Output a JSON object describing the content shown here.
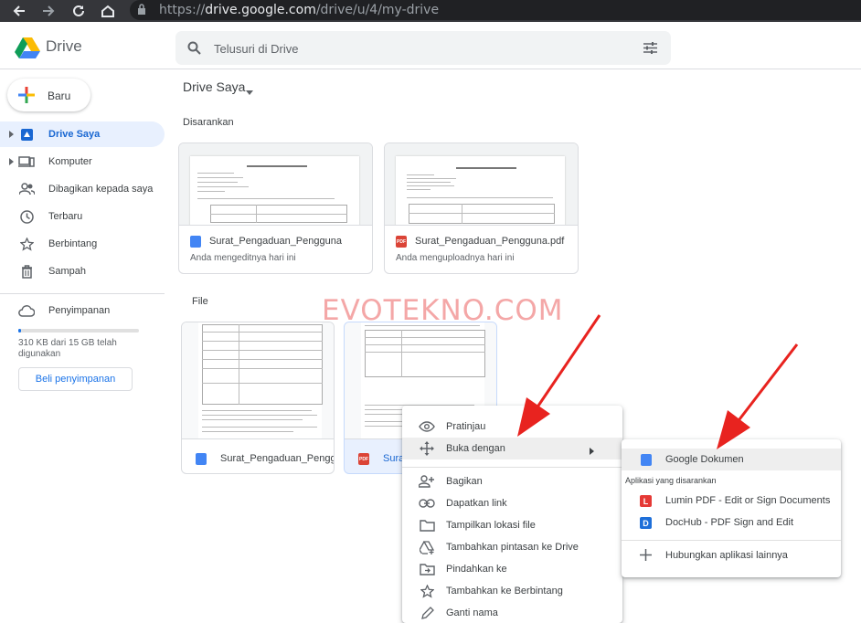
{
  "browser": {
    "url_prefix": "https://",
    "url_host": "drive.google.com",
    "url_path": "/drive/u/4/my-drive"
  },
  "header": {
    "app_name": "Drive",
    "search_placeholder": "Telusuri di Drive"
  },
  "sidebar": {
    "new_label": "Baru",
    "items": [
      {
        "label": "Drive Saya",
        "icon": "my-drive-icon",
        "active": true
      },
      {
        "label": "Komputer",
        "icon": "computer-icon"
      },
      {
        "label": "Dibagikan kepada saya",
        "icon": "shared-icon"
      },
      {
        "label": "Terbaru",
        "icon": "clock-icon"
      },
      {
        "label": "Berbintang",
        "icon": "star-icon"
      },
      {
        "label": "Sampah",
        "icon": "trash-icon"
      }
    ],
    "storage_label": "Penyimpanan",
    "storage_text": "310 KB dari 15 GB telah digunakan",
    "storage_fraction": 2e-05,
    "buy_label": "Beli penyimpanan"
  },
  "main": {
    "breadcrumb": "Drive Saya",
    "suggested_heading": "Disarankan",
    "file_heading": "File",
    "suggested": [
      {
        "name": "Surat_Pengaduan_Pengguna",
        "type": "doc",
        "activity": "Anda mengeditnya hari ini"
      },
      {
        "name": "Surat_Pengaduan_Pengguna.pdf",
        "type": "pdf",
        "activity": "Anda menguploadnya hari ini"
      }
    ],
    "files": [
      {
        "name": "Surat_Pengaduan_Pengg",
        "type": "doc"
      },
      {
        "name": "Surat",
        "type": "pdf"
      }
    ]
  },
  "watermark": "EVOTEKNO.COM",
  "context_menu": {
    "items": [
      {
        "label": "Pratinjau",
        "icon": "eye-icon"
      },
      {
        "label": "Buka dengan",
        "icon": "move-arrows-icon",
        "submenu": true
      },
      {
        "label": "Bagikan",
        "icon": "person-add-icon"
      },
      {
        "label": "Dapatkan link",
        "icon": "link-icon"
      },
      {
        "label": "Tampilkan lokasi file",
        "icon": "folder-icon"
      },
      {
        "label": "Tambahkan pintasan ke Drive",
        "icon": "drive-add-icon"
      },
      {
        "label": "Pindahkan ke",
        "icon": "folder-move-icon"
      },
      {
        "label": "Tambahkan ke Berbintang",
        "icon": "star-icon"
      },
      {
        "label": "Ganti nama",
        "icon": "pencil-icon"
      }
    ]
  },
  "open_with_menu": {
    "primary": {
      "label": "Google Dokumen",
      "icon": "google-docs-icon"
    },
    "section_label": "Aplikasi yang disarankan",
    "apps": [
      {
        "label": "Lumin PDF - Edit or Sign Documents",
        "icon": "lumin-icon",
        "color": "#e53935",
        "glyph": "L"
      },
      {
        "label": "DocHub - PDF Sign and Edit",
        "icon": "dochub-icon",
        "color": "#1e6fd9",
        "glyph": "D"
      }
    ],
    "connect_label": "Hubungkan aplikasi lainnya"
  },
  "colors": {
    "accent": "#1a73e8",
    "active_bg": "#e8f0fe",
    "arrow": "#e8231f"
  }
}
